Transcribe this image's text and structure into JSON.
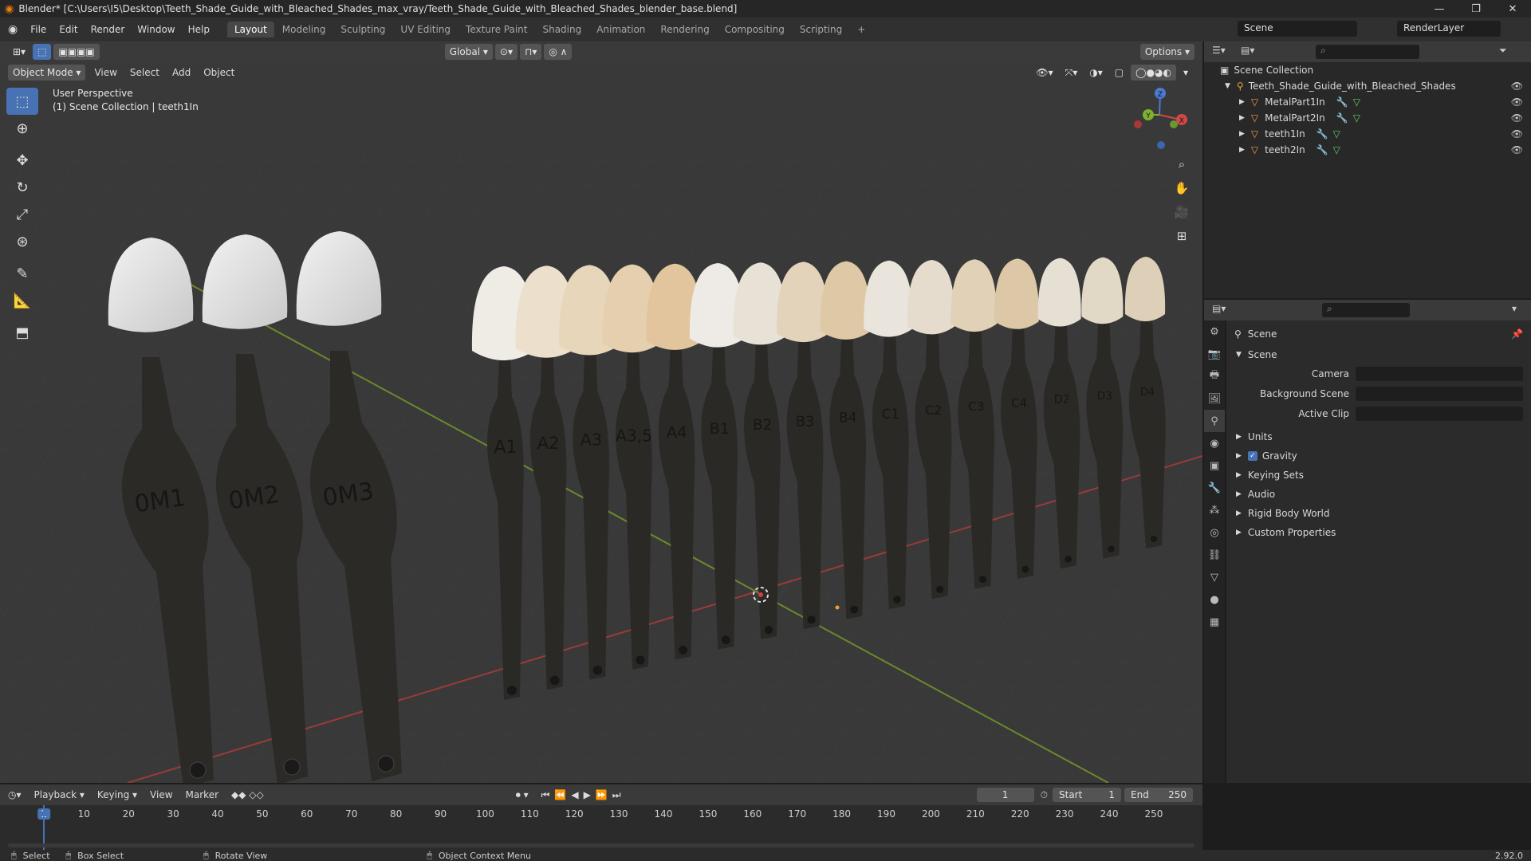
{
  "window": {
    "title": "Blender* [C:\\Users\\I5\\Desktop\\Teeth_Shade_Guide_with_Bleached_Shades_max_vray/Teeth_Shade_Guide_with_Bleached_Shades_blender_base.blend]"
  },
  "menu": [
    "File",
    "Edit",
    "Render",
    "Window",
    "Help"
  ],
  "workspaces": [
    "Layout",
    "Modeling",
    "Sculpting",
    "UV Editing",
    "Texture Paint",
    "Shading",
    "Animation",
    "Rendering",
    "Compositing",
    "Scripting"
  ],
  "active_workspace": "Layout",
  "scene_name": "Scene",
  "render_layer": "RenderLayer",
  "viewport_header": {
    "transform": "Global",
    "options": "Options",
    "mode": "Object Mode",
    "menus": [
      "View",
      "Select",
      "Add",
      "Object"
    ]
  },
  "viewport_overlay": {
    "line1": "User Perspective",
    "line2": "(1) Scene Collection | teeth1In"
  },
  "gizmo": {
    "x": "X",
    "y": "Y",
    "z": "Z"
  },
  "teeth_labels_left": [
    "0M1",
    "0M2",
    "0M3"
  ],
  "teeth_labels_right": [
    "A1",
    "A2",
    "A3",
    "A3,5",
    "A4",
    "B1",
    "B2",
    "B3",
    "B4",
    "C1",
    "C2",
    "C3",
    "C4",
    "D2",
    "D3",
    "D4"
  ],
  "outliner": {
    "root": "Scene Collection",
    "collection": "Teeth_Shade_Guide_with_Bleached_Shades",
    "objects": [
      "MetalPart1In",
      "MetalPart2In",
      "teeth1In",
      "teeth2In"
    ]
  },
  "properties": {
    "context": "Scene",
    "panel": "Scene",
    "fields": [
      "Camera",
      "Background Scene",
      "Active Clip"
    ],
    "sections": [
      "Units",
      "Gravity",
      "Keying Sets",
      "Audio",
      "Rigid Body World",
      "Custom Properties"
    ],
    "gravity_checked": true
  },
  "timeline": {
    "menus": [
      "Playback",
      "Keying",
      "View",
      "Marker"
    ],
    "current_frame": "1",
    "start_label": "Start",
    "start": "1",
    "end_label": "End",
    "end": "250",
    "ruler": [
      "1",
      "10",
      "20",
      "30",
      "40",
      "50",
      "60",
      "70",
      "80",
      "90",
      "100",
      "110",
      "120",
      "130",
      "140",
      "150",
      "160",
      "170",
      "180",
      "190",
      "200",
      "210",
      "220",
      "230",
      "240",
      "250"
    ]
  },
  "status": {
    "select": "Select",
    "box_select": "Box Select",
    "rotate": "Rotate View",
    "context_menu": "Object Context Menu",
    "version": "2.92.0"
  },
  "colors": {
    "accent": "#4772b3",
    "x_axis": "#9b3a3a",
    "y_axis": "#6a8a2a"
  }
}
